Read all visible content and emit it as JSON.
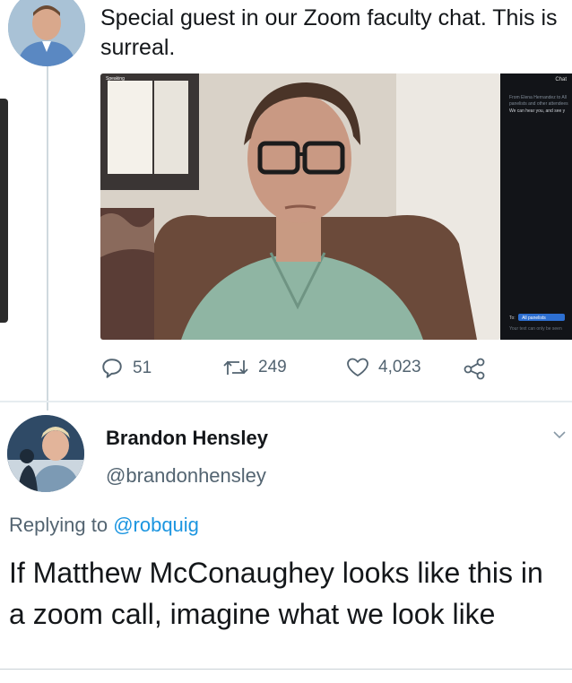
{
  "original_tweet": {
    "text": "Special guest in our Zoom faculty chat. This is surreal.",
    "media": {
      "speaker_label": "Speaking",
      "chat_panel": {
        "title": "Chat",
        "messages": [
          "From Elena Hernandez to All",
          "panelists and other attendees",
          "We can hear you, and see y"
        ],
        "to_label": "To:",
        "to_value": "All panelists",
        "input_placeholder": "Your text can only be seen"
      }
    },
    "actions": {
      "replies": "51",
      "retweets": "249",
      "likes": "4,023"
    }
  },
  "reply_tweet": {
    "display_name": "Brandon Hensley",
    "handle": "@brandonhensley",
    "replying_prefix": "Replying to ",
    "replying_to": "@robquig",
    "text": "If Matthew McConaughey looks like this in a zoom call, imagine what we look like"
  },
  "icons": {
    "reply": "reply-icon",
    "retweet": "retweet-icon",
    "like": "heart-icon",
    "share": "share-icon",
    "more": "chevron-down-icon"
  },
  "colors": {
    "text_primary": "#14171a",
    "text_secondary": "#536471",
    "link": "#1b95e0",
    "zoom_panel": "#121418"
  }
}
